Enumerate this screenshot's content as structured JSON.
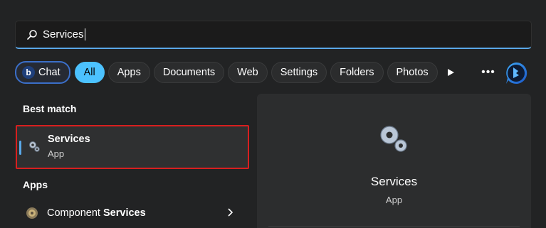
{
  "search": {
    "value": "Services",
    "icon": "search-icon"
  },
  "filters": {
    "chat_label": "Chat",
    "chips": [
      "All",
      "Apps",
      "Documents",
      "Web",
      "Settings",
      "Folders",
      "Photos"
    ],
    "active": "All",
    "accent_color": "#4cc2ff"
  },
  "toolbar": {
    "play_icon": "play-icon",
    "more_label": "•••",
    "bing_icon": "bing-icon"
  },
  "best_match": {
    "heading": "Best match",
    "title": "Services",
    "subtitle": "App",
    "highlight_color": "#d81f1f"
  },
  "apps": {
    "heading": "Apps",
    "items": [
      {
        "prefix": "Component ",
        "match": "Services"
      }
    ]
  },
  "preview": {
    "title": "Services",
    "subtitle": "App"
  }
}
